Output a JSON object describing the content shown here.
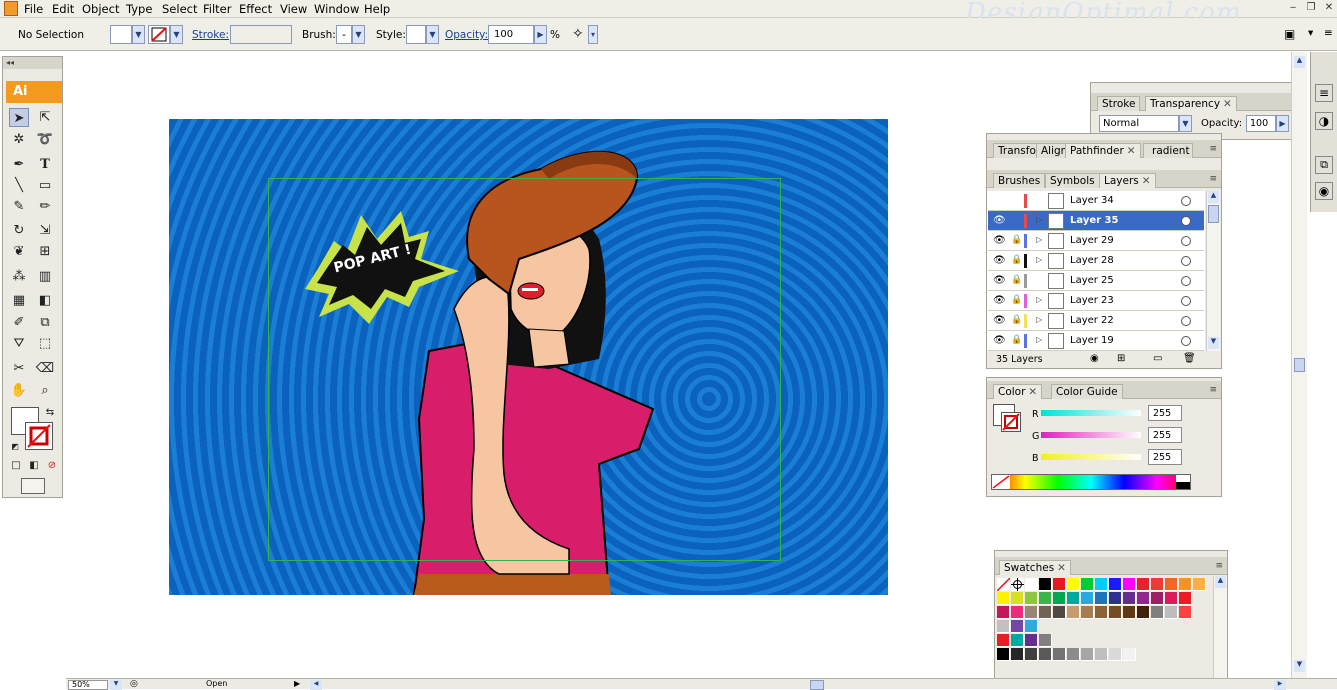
{
  "app": {
    "icon": "ai-app-icon",
    "watermark": "DesignOptimal.com"
  },
  "menu": [
    "File",
    "Edit",
    "Object",
    "Type",
    "Select",
    "Filter",
    "Effect",
    "View",
    "Window",
    "Help"
  ],
  "control_bar": {
    "selection": "No Selection",
    "stroke_label": "Stroke:",
    "brush_label": "Brush:",
    "brush_value": "-",
    "style_label": "Style:",
    "opacity_label": "Opacity:",
    "opacity_value": "100",
    "percent": "%"
  },
  "toolbox": {
    "badge": "Ai",
    "header": "◂◂"
  },
  "artwork": {
    "speech_text": "POP ART !"
  },
  "transparency_panel": {
    "tabs": [
      "Stroke",
      "Transparency"
    ],
    "blend_mode": "Normal",
    "opacity_label": "Opacity:",
    "opacity_value": "100",
    "percent": "%"
  },
  "align_panel": {
    "tabs": [
      "Transfo",
      "Align",
      "Pathfinder",
      "radient"
    ]
  },
  "layers_panel": {
    "tabs": [
      "Brushes",
      "Symbols",
      "Layers"
    ],
    "layers": [
      {
        "name": "Layer 34",
        "color": "#e84a4a",
        "visible": false,
        "locked": false,
        "expand": false
      },
      {
        "name": "Layer 35",
        "color": "#e84a4a",
        "visible": true,
        "locked": false,
        "expand": true,
        "selected": true
      },
      {
        "name": "Layer 29",
        "color": "#5a73e0",
        "visible": true,
        "locked": true,
        "expand": true
      },
      {
        "name": "Layer 28",
        "color": "#111111",
        "visible": true,
        "locked": true,
        "expand": true
      },
      {
        "name": "Layer 25",
        "color": "#9a9a9a",
        "visible": true,
        "locked": true,
        "expand": false
      },
      {
        "name": "Layer 23",
        "color": "#e060e0",
        "visible": true,
        "locked": true,
        "expand": true
      },
      {
        "name": "Layer 22",
        "color": "#f4e05a",
        "visible": true,
        "locked": true,
        "expand": true
      },
      {
        "name": "Layer 19",
        "color": "#5a73e0",
        "visible": true,
        "locked": true,
        "expand": true
      }
    ],
    "count": "35 Layers"
  },
  "color_panel": {
    "tabs": [
      "Color",
      "Color Guide"
    ],
    "channels": [
      {
        "label": "R",
        "value": "255",
        "gradient": "linear-gradient(to right,#00e0d8,#ffffff)"
      },
      {
        "label": "G",
        "value": "255",
        "gradient": "linear-gradient(to right,#e020c0,#ffffff)"
      },
      {
        "label": "B",
        "value": "255",
        "gradient": "linear-gradient(to right,#f0f020,#ffffff)"
      }
    ]
  },
  "swatches_panel": {
    "tabs": [
      "Swatches"
    ]
  },
  "status_bar": {
    "zoom": "50%",
    "status": "Open"
  }
}
